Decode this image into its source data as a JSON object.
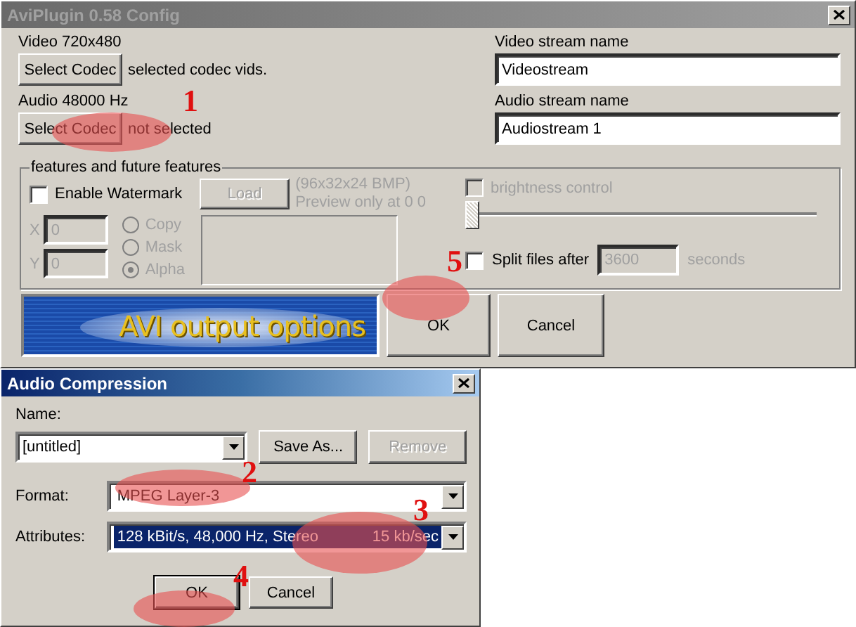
{
  "config_window": {
    "title": "AviPlugin 0.58 Config",
    "video": {
      "label": "Video  720x480",
      "button": "Select Codec",
      "status": "selected codec vids.",
      "stream_label": "Video stream name",
      "stream_value": "Videostream"
    },
    "audio": {
      "label": "Audio  48000 Hz",
      "button": "Select Codec",
      "status": "not selected",
      "stream_label": "Audio stream name",
      "stream_value": "Audiostream 1"
    },
    "features": {
      "legend": "features and future features",
      "watermark": {
        "label": "Enable Watermark",
        "checked": false
      },
      "load_button": {
        "label": "Load",
        "disabled": true
      },
      "hint_lines": [
        "(96x32x24 BMP)",
        "Preview only at 0 0"
      ],
      "offsets": [
        {
          "label": "X",
          "value": "0",
          "disabled": true
        },
        {
          "label": "Y",
          "value": "0",
          "disabled": true
        }
      ],
      "modes": [
        {
          "label": "Copy",
          "selected": false,
          "disabled": true
        },
        {
          "label": "Mask",
          "selected": false,
          "disabled": true
        },
        {
          "label": "Alpha",
          "selected": true,
          "disabled": true
        }
      ],
      "brightness": {
        "label": "brightness control",
        "checked": false,
        "disabled": true,
        "level": 0
      },
      "split": {
        "label": "Split files after",
        "checked": false,
        "value": "3600",
        "unit": "seconds",
        "disabled": true
      }
    },
    "banner": "AVI output options",
    "buttons": [
      "OK",
      "Cancel"
    ]
  },
  "audio_dialog": {
    "title": "Audio Compression",
    "name_label": "Name:",
    "name_value": "[untitled]",
    "name_buttons": [
      {
        "label": "Save As...",
        "disabled": false
      },
      {
        "label": "Remove",
        "disabled": true
      }
    ],
    "fields": [
      {
        "label": "Format:",
        "value": "MPEG Layer-3",
        "selected": false
      },
      {
        "label": "Attributes:",
        "value": "128 kBit/s, 48,000 Hz, Stereo",
        "rate": "15 kb/sec",
        "selected": true
      }
    ],
    "buttons": [
      {
        "label": "OK",
        "default": true
      },
      {
        "label": "Cancel",
        "default": false
      }
    ]
  },
  "annotations": [
    {
      "label": "1"
    },
    {
      "label": "2"
    },
    {
      "label": "3"
    },
    {
      "label": "4"
    },
    {
      "label": "5"
    }
  ]
}
